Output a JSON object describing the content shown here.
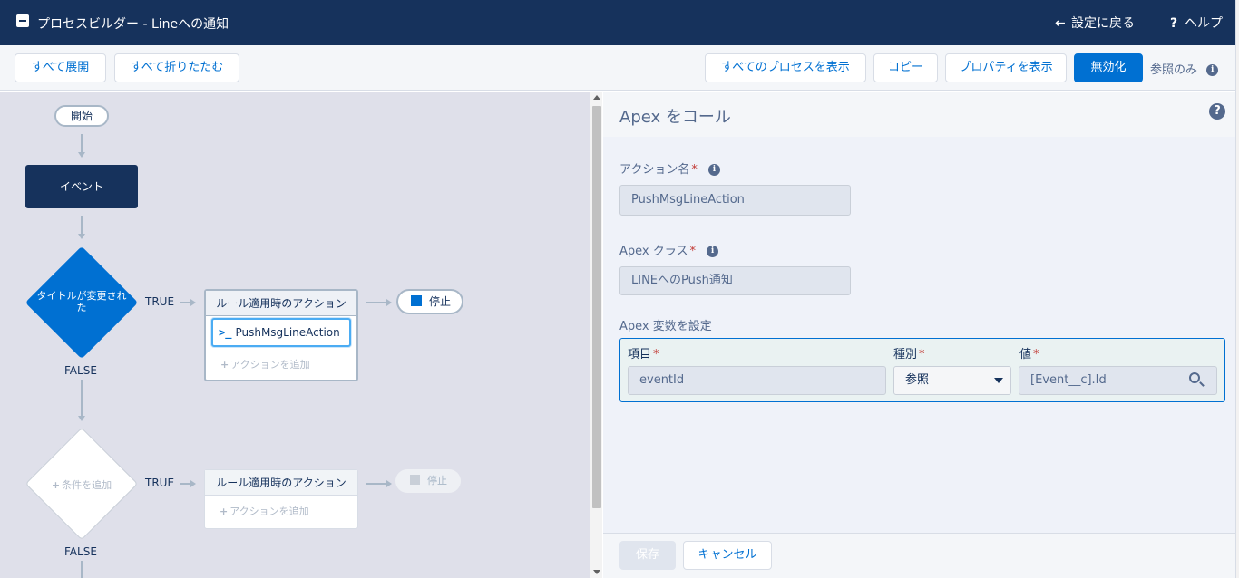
{
  "header": {
    "title": "プロセスビルダー - Lineへの通知",
    "back_label": "設定に戻る",
    "help_label": "ヘルプ"
  },
  "toolbar": {
    "expand_all": "すべて展開",
    "collapse_all": "すべて折りたたむ",
    "show_all_processes": "すべてのプロセスを表示",
    "copy": "コピー",
    "show_properties": "プロパティを表示",
    "deactivate": "無効化",
    "readonly": "参照のみ"
  },
  "canvas": {
    "start_label": "開始",
    "event_label": "イベント",
    "criteria_1": "タイトルが変更された",
    "criteria_2_add": "条件を追加",
    "true_label": "TRUE",
    "false_label": "FALSE",
    "action_group_title": "ルール適用時のアクション",
    "action_item": "PushMsgLineAction",
    "add_action": "アクションを追加",
    "stop_label": "停止"
  },
  "panel": {
    "title": "Apex をコール",
    "action_name_label": "アクション名",
    "action_name_value": "PushMsgLineAction",
    "apex_class_label": "Apex クラス",
    "apex_class_value": "LINEへのPush通知",
    "variables_label": "Apex 変数を設定",
    "col_field": "項目",
    "col_type": "種別",
    "col_value": "値",
    "var_field": "eventId",
    "var_type": "参照",
    "var_value": "[Event__c].Id",
    "save_label": "保存",
    "cancel_label": "キャンセル"
  },
  "colors": {
    "header_bg": "#16325c",
    "primary": "#0070d2",
    "criteria_fill": "#0070d2"
  }
}
